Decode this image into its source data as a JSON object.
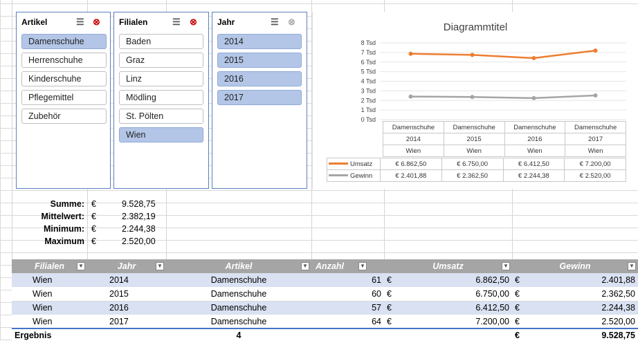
{
  "slicers": [
    {
      "title": "Artikel",
      "items": [
        {
          "label": "Damenschuhe",
          "selected": true
        },
        {
          "label": "Herrenschuhe",
          "selected": false
        },
        {
          "label": "Kinderschuhe",
          "selected": false
        },
        {
          "label": "Pflegemittel",
          "selected": false
        },
        {
          "label": "Zubehör",
          "selected": false
        }
      ]
    },
    {
      "title": "Filialen",
      "items": [
        {
          "label": "Baden",
          "selected": false
        },
        {
          "label": "Graz",
          "selected": false
        },
        {
          "label": "Linz",
          "selected": false
        },
        {
          "label": "Mödling",
          "selected": false
        },
        {
          "label": "St. Pölten",
          "selected": false
        },
        {
          "label": "Wien",
          "selected": true
        }
      ]
    },
    {
      "title": "Jahr",
      "items": [
        {
          "label": "2014",
          "selected": true
        },
        {
          "label": "2015",
          "selected": true
        },
        {
          "label": "2016",
          "selected": true
        },
        {
          "label": "2017",
          "selected": true
        }
      ]
    }
  ],
  "chart_data": {
    "type": "line",
    "title": "Diagrammtitel",
    "y_ticks": [
      "0 Tsd",
      "1 Tsd",
      "2 Tsd",
      "3 Tsd",
      "4 Tsd",
      "5 Tsd",
      "6 Tsd",
      "7 Tsd",
      "8 Tsd"
    ],
    "ylim": [
      0,
      8000
    ],
    "categories": [
      [
        "Damenschuhe",
        "2014",
        "Wien"
      ],
      [
        "Damenschuhe",
        "2015",
        "Wien"
      ],
      [
        "Damenschuhe",
        "2016",
        "Wien"
      ],
      [
        "Damenschuhe",
        "2017",
        "Wien"
      ]
    ],
    "series": [
      {
        "name": "Umsatz",
        "color": "#ed7d31",
        "values": [
          6862.5,
          6750,
          6412.5,
          7200
        ],
        "labels": [
          "€ 6.862,50",
          "€ 6.750,00",
          "€ 6.412,50",
          "€ 7.200,00"
        ]
      },
      {
        "name": "Gewinn",
        "color": "#a5a5a5",
        "values": [
          2401.88,
          2362.5,
          2244.38,
          2520
        ],
        "labels": [
          "€ 2.401,88",
          "€ 2.362,50",
          "€ 2.244,38",
          "€ 2.520,00"
        ]
      }
    ]
  },
  "stats": [
    {
      "label": "Summe:",
      "cur": "€",
      "value": "9.528,75"
    },
    {
      "label": "Mittelwert:",
      "cur": "€",
      "value": "2.382,19"
    },
    {
      "label": "Minimum:",
      "cur": "€",
      "value": "2.244,38"
    },
    {
      "label": "Maximum",
      "cur": "€",
      "value": "2.520,00"
    }
  ],
  "table": {
    "headers": [
      "Filialen",
      "Jahr",
      "Artikel",
      "Anzahl",
      "Umsatz",
      "Gewinn"
    ],
    "rows": [
      {
        "filiale": "Wien",
        "jahr": "2014",
        "artikel": "Damenschuhe",
        "anzahl": "61",
        "cur1": "€",
        "umsatz": "6.862,50",
        "cur2": "€",
        "gewinn": "2.401,88"
      },
      {
        "filiale": "Wien",
        "jahr": "2015",
        "artikel": "Damenschuhe",
        "anzahl": "60",
        "cur1": "€",
        "umsatz": "6.750,00",
        "cur2": "€",
        "gewinn": "2.362,50"
      },
      {
        "filiale": "Wien",
        "jahr": "2016",
        "artikel": "Damenschuhe",
        "anzahl": "57",
        "cur1": "€",
        "umsatz": "6.412,50",
        "cur2": "€",
        "gewinn": "2.244,38"
      },
      {
        "filiale": "Wien",
        "jahr": "2017",
        "artikel": "Damenschuhe",
        "anzahl": "64",
        "cur1": "€",
        "umsatz": "7.200,00",
        "cur2": "€",
        "gewinn": "2.520,00"
      }
    ],
    "total": {
      "label": "Ergebnis",
      "artikel": "4",
      "cur": "€",
      "gewinn": "9.528,75"
    }
  }
}
